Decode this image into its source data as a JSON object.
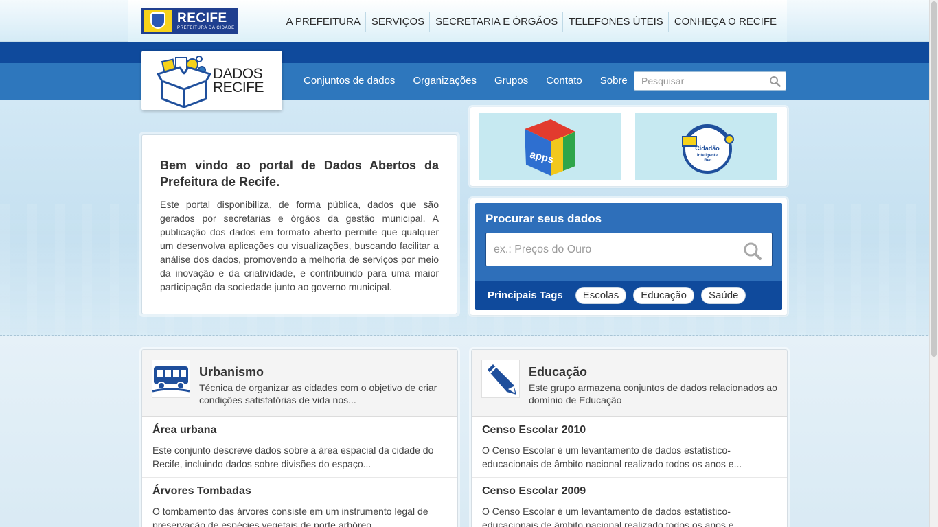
{
  "gov_bar": {
    "logo_title": "RECIFE",
    "logo_subtitle": "PREFEITURA DA CIDADE",
    "nav": [
      "A PREFEITURA",
      "SERVIÇOS",
      "SECRETARIA E ÓRGÃOS",
      "TELEFONES ÚTEIS",
      "CONHEÇA O RECIFE"
    ]
  },
  "site_logo": {
    "line1": "DADOS",
    "line2": "RECIFE"
  },
  "main_nav": [
    "Conjuntos de dados",
    "Organizações",
    "Grupos",
    "Contato",
    "Sobre"
  ],
  "top_search": {
    "placeholder": "Pesquisar"
  },
  "welcome": {
    "title": "Bem vindo ao portal de Dados Abertos da Prefeitura de Recife.",
    "body": "Este portal disponibiliza, de forma pública, dados que são gerados por secretarias e órgãos da gestão municipal. A publicação dos dados em formato aberto permite que qualquer um desenvolva aplicações ou visualizações, buscando facilitar a análise dos dados, promovendo a melhoria de serviços por meio da inovação e da criatividade, e contribuindo para uma maior participação da sociedade junto ao governo municipal."
  },
  "promo": {
    "apps_label": "apps",
    "cidadao_line1": "Cidadão",
    "cidadao_line2": "Inteligente",
    "cidadao_line3": ".Rec"
  },
  "search_box": {
    "title": "Procurar seus dados",
    "placeholder": "ex.: Preços do Ouro",
    "tags_label": "Principais Tags",
    "tags": [
      "Escolas",
      "Educação",
      "Saúde"
    ]
  },
  "groups": [
    {
      "title": "Urbanismo",
      "description": "Técnica de organizar as cidades com o objetivo de criar condições satisfatórias de vida nos...",
      "datasets": [
        {
          "title": "Área urbana",
          "description": "Este conjunto descreve dados sobre a área espacial da cidade do Recife, incluindo dados sobre divisões do espaço..."
        },
        {
          "title": "Árvores Tombadas",
          "description": "O tombamento das árvores consiste em um instrumento legal de preservação de espécies vegetais de porte arbóreo...."
        }
      ]
    },
    {
      "title": "Educação",
      "description": "Este grupo armazena conjuntos de dados relacionados ao domínio de Educação",
      "datasets": [
        {
          "title": "Censo Escolar 2010",
          "description": "O Censo Escolar é um levantamento de dados estatístico-educacionais de âmbito nacional realizado todos os anos e..."
        },
        {
          "title": "Censo Escolar 2009",
          "description": "O Censo Escolar é um levantamento de dados estatístico-educacionais de âmbito nacional realizado todos os anos e..."
        }
      ]
    }
  ],
  "colors": {
    "brand_dark": "#0f4a9c",
    "brand_light": "#2e77bd",
    "accent_yellow": "#f6d21a"
  }
}
